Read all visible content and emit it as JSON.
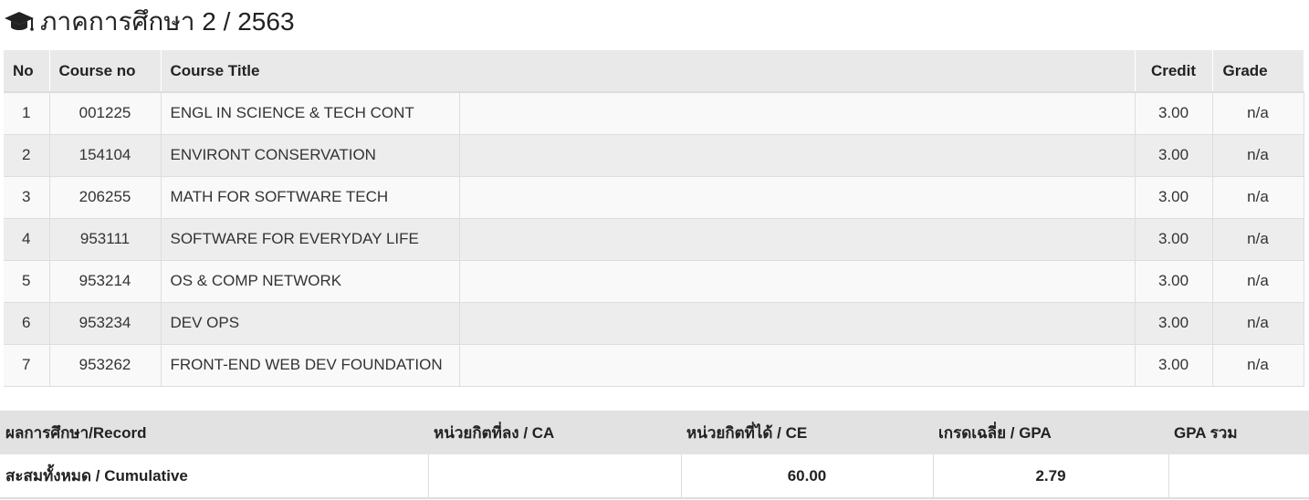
{
  "semester": {
    "icon": "graduation-cap-icon",
    "title": "ภาคการศึกษา 2 / 2563"
  },
  "courses": {
    "headers": {
      "no": "No",
      "course_no": "Course no",
      "title": "Course Title",
      "credit": "Credit",
      "grade": "Grade"
    },
    "rows": [
      {
        "no": "1",
        "code": "001225",
        "title": "ENGL IN SCIENCE & TECH CONT",
        "credit": "3.00",
        "grade": "n/a"
      },
      {
        "no": "2",
        "code": "154104",
        "title": "ENVIRONT CONSERVATION",
        "credit": "3.00",
        "grade": "n/a"
      },
      {
        "no": "3",
        "code": "206255",
        "title": "MATH FOR SOFTWARE TECH",
        "credit": "3.00",
        "grade": "n/a"
      },
      {
        "no": "4",
        "code": "953111",
        "title": "SOFTWARE FOR EVERYDAY LIFE",
        "credit": "3.00",
        "grade": "n/a"
      },
      {
        "no": "5",
        "code": "953214",
        "title": "OS & COMP NETWORK",
        "credit": "3.00",
        "grade": "n/a"
      },
      {
        "no": "6",
        "code": "953234",
        "title": "DEV OPS",
        "credit": "3.00",
        "grade": "n/a"
      },
      {
        "no": "7",
        "code": "953262",
        "title": "FRONT-END WEB DEV FOUNDATION",
        "credit": "3.00",
        "grade": "n/a"
      }
    ]
  },
  "summary": {
    "headers": {
      "record": "ผลการศึกษา/Record",
      "ca": "หน่วยกิตที่ลง / CA",
      "ce": "หน่วยกิตที่ได้ / CE",
      "gpa": "เกรดเฉลี่ย / GPA",
      "gpa_total": "GPA รวม"
    },
    "cumulative": {
      "label": "สะสมทั้งหมด / Cumulative",
      "ca": "",
      "ce": "60.00",
      "gpa": "2.79",
      "gpa_total": ""
    }
  }
}
